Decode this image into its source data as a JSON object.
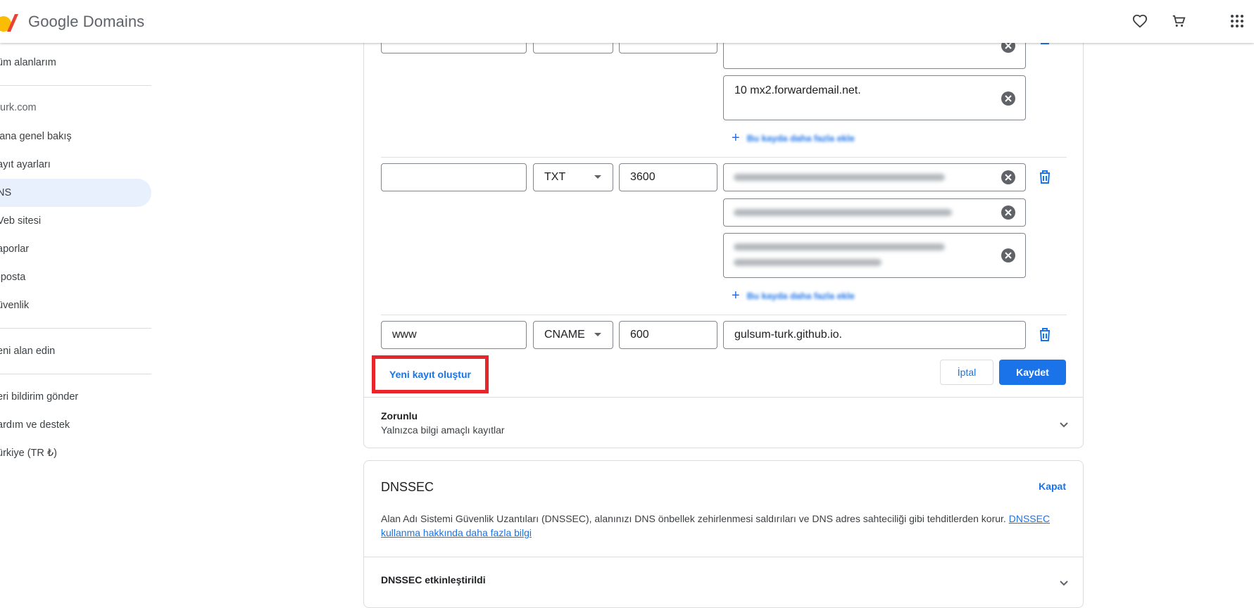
{
  "app": {
    "brand": "Google Domains",
    "colors": {
      "accent": "#1a73e8",
      "highlight": "#e8252a",
      "active_bg": "#e8f0fe"
    }
  },
  "header_icons": [
    "heart-icon",
    "cart-icon",
    "apps-grid-icon"
  ],
  "sidebar": {
    "all_domains": "üm alanlarım",
    "domain": "turk.com",
    "items": [
      {
        "label": "lana genel bakış"
      },
      {
        "label": "ayıt ayarları"
      },
      {
        "label": "NS"
      },
      {
        "label": "Veb sitesi"
      },
      {
        "label": "aporlar"
      },
      {
        "label": "-posta"
      },
      {
        "label": "üvenlik"
      }
    ],
    "get_new": "eni alan edin",
    "footer": [
      {
        "label": "eri bildirim gönder"
      },
      {
        "label": "ardım ve destek"
      },
      {
        "label": "ürkiye (TR ₺)"
      }
    ]
  },
  "records": {
    "mx": {
      "value2": "10 mx2.forwardemail.net.",
      "add_more": "Bu kayda daha fazla ekle"
    },
    "txt": {
      "host": "",
      "type": "TXT",
      "ttl": "3600",
      "add_more": "Bu kayda daha fazla ekle"
    },
    "cname": {
      "host": "www",
      "type": "CNAME",
      "ttl": "600",
      "data": "gulsum-turk.github.io."
    }
  },
  "actions": {
    "new_record": "Yeni kayıt oluştur",
    "cancel": "İptal",
    "save": "Kaydet"
  },
  "required": {
    "title": "Zorunlu",
    "subtitle": "Yalnızca bilgi amaçlı kayıtlar"
  },
  "dnssec": {
    "title": "DNSSEC",
    "close": "Kapat",
    "description": "Alan Adı Sistemi Güvenlik Uzantıları (DNSSEC), alanınızı DNS önbellek zehirlenmesi saldırıları ve DNS adres sahteciliği gibi tehditlerden korur.",
    "link": "DNSSEC kullanma hakkında daha fazla bilgi",
    "status": "DNSSEC etkinleştirildi"
  }
}
